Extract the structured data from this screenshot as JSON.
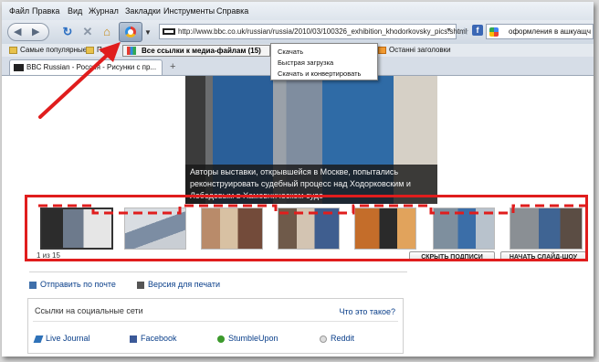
{
  "menu": [
    "Файл",
    "Правка",
    "Вид",
    "Журнал",
    "Закладки",
    "Инструменты",
    "Справка"
  ],
  "toolbar": {
    "back_icon": "back-arrow-icon",
    "forward_icon": "forward-arrow-icon",
    "reload_icon": "reload-icon",
    "stop_icon": "stop-icon",
    "home_icon": "home-icon",
    "downloader_icon": "download-manager-icon",
    "url": "http://www.bbc.co.uk/russian/russia/2010/03/100326_exhibition_khodorkovsky_pics.shtml",
    "search_text": "оформления в ашкуащч"
  },
  "bookmarks": {
    "items": [
      "Самые популярные",
      "Пе",
      "Останні заголовки"
    ],
    "media_button": "Все ссылки к медиа-файлам (15)"
  },
  "context_menu": [
    "Скачать",
    "Быстрая загрузка",
    "Скачать и конвертировать"
  ],
  "tab": {
    "title": "BBC Russian - Россия - Рисунки с пр...",
    "new_tab": "+"
  },
  "page": {
    "caption_lines": [
      "Авторы выставки, открывшейся в Москве, попытались",
      "реконструировать судебный процесс над Ходорковским и",
      "Лебедевым в Хамовническом суде"
    ],
    "counter": "1 из 15",
    "btn_captions": "СКРЫТЬ ПОДПИСИ",
    "btn_slideshow": "НАЧАТЬ СЛАЙД-ШОУ",
    "send_mail": "Отправить по почте",
    "print_version": "Версия для печати",
    "social_title": "Ссылки на социальные сети",
    "what_is_this": "Что это такое?",
    "social": [
      "Live Journal",
      "Facebook",
      "StumbleUpon",
      "Reddit"
    ]
  },
  "colors": {
    "annotation_red": "#e01d1d",
    "link_blue": "#0a3f8a"
  }
}
